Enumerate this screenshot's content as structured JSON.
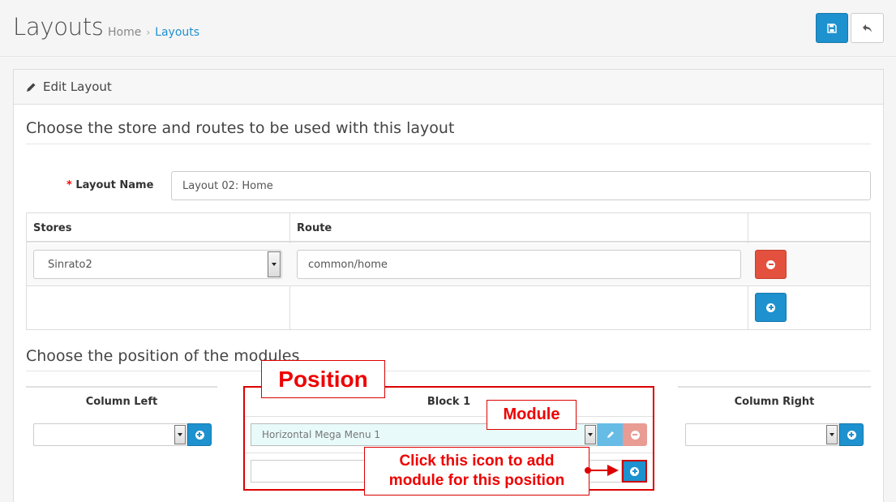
{
  "header": {
    "title": "Layouts",
    "breadcrumb": {
      "home": "Home",
      "separator": "›",
      "current": "Layouts"
    },
    "buttons": {
      "save_icon": "floppy-disk-icon",
      "back_icon": "reply-icon"
    }
  },
  "panel": {
    "heading": "Edit Layout",
    "heading_icon": "pencil-icon"
  },
  "section_routes": {
    "legend": "Choose the store and routes to be used with this layout",
    "layout_name": {
      "required_mark": "*",
      "label": "Layout Name",
      "value": "Layout 02: Home"
    },
    "table": {
      "headers": [
        "Stores",
        "Route",
        ""
      ],
      "rows": [
        {
          "store": "Sinrato2",
          "route": "common/home"
        }
      ]
    }
  },
  "section_modules": {
    "legend": "Choose the position of the modules",
    "columns": {
      "left": "Column Left",
      "block": "Block 1",
      "right": "Column Right"
    },
    "block_module_value": "Horizontal Mega Menu 1"
  },
  "annotations": {
    "position": "Position",
    "module": "Module",
    "click_line1": "Click this icon to add",
    "click_line2": "module for this position"
  },
  "colors": {
    "primary": "#1e91cf",
    "danger": "#e3503e",
    "annotation": "#dd0000"
  }
}
